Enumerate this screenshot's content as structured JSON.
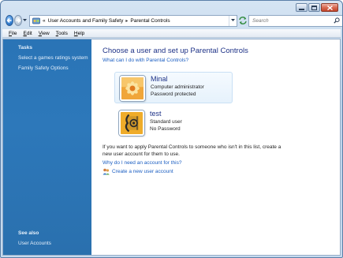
{
  "window": {
    "controls": [
      "minimize",
      "maximize",
      "close"
    ]
  },
  "address_bar": {
    "prefix": "«",
    "crumbs": [
      "User Accounts and Family Safety",
      "Parental Controls"
    ],
    "icon": "control-panel-icon"
  },
  "search": {
    "placeholder": "Search"
  },
  "menu": {
    "items": [
      "File",
      "Edit",
      "View",
      "Tools",
      "Help"
    ]
  },
  "sidebar": {
    "tasks_heading": "Tasks",
    "tasks": [
      "Select a games ratings system",
      "Family Safety Options"
    ],
    "see_also_heading": "See also",
    "see_also": [
      "User Accounts"
    ]
  },
  "main": {
    "title": "Choose a user and set up Parental Controls",
    "help_link": "What can I do with Parental Controls?",
    "users": [
      {
        "name": "Minal",
        "role": "Computer administrator",
        "password": "Password protected",
        "picture": "flower-picture",
        "selected": true
      },
      {
        "name": "test",
        "role": "Standard user",
        "password": "No Password",
        "picture": "guitar-picture",
        "selected": false
      }
    ],
    "info_text": "If you want to apply Parental Controls to someone who isn't in this list, create a new user account for them to use.",
    "why_link": "Why do I need an account for this?",
    "create_link": "Create a new user account"
  },
  "colors": {
    "sidebar": "#2d78ba",
    "title": "#1e3287",
    "link": "#1b5ec2"
  }
}
